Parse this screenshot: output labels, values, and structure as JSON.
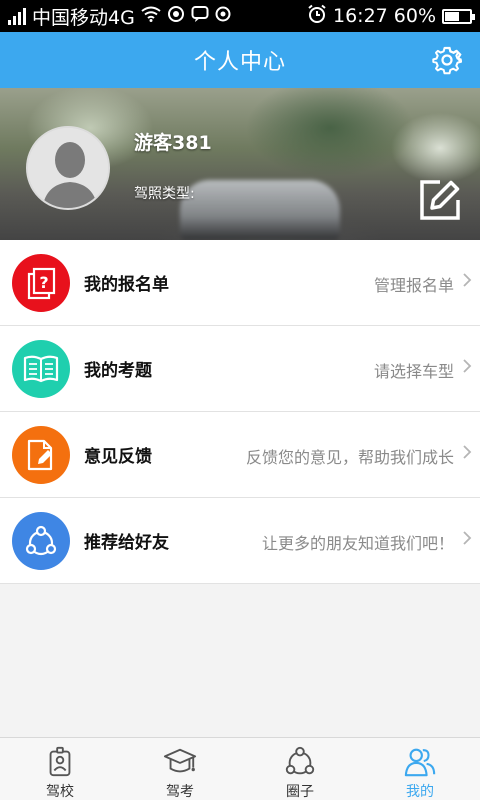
{
  "status_bar": {
    "carrier": "中国移动4G",
    "time": "16:27",
    "battery_percent": "60%",
    "battery_level": 0.6,
    "icons": [
      "signal-icon",
      "wifi-icon",
      "sync-icon",
      "chat-icon",
      "location-icon",
      "alarm-icon",
      "battery-icon"
    ]
  },
  "header": {
    "title": "个人中心",
    "settings_icon": "gear-icon"
  },
  "profile": {
    "username": "游客381",
    "license_type_label": "驾照类型:",
    "avatar_icon": "user-silhouette-icon",
    "edit_icon": "edit-icon"
  },
  "menu": {
    "items": [
      {
        "label": "我的报名单",
        "hint": "管理报名单",
        "icon": "question-doc-icon",
        "color": "#e8111c"
      },
      {
        "label": "我的考题",
        "hint": "请选择车型",
        "icon": "open-book-icon",
        "color": "#1fcfae"
      },
      {
        "label": "意见反馈",
        "hint": "反馈您的意见，帮助我们成长",
        "icon": "doc-pen-icon",
        "color": "#f4700f"
      },
      {
        "label": "推荐给好友",
        "hint": "让更多的朋友知道我们吧！",
        "icon": "share-icon",
        "color": "#3f86e4"
      }
    ],
    "chevron": "chevron-right-icon"
  },
  "bottom_nav": {
    "items": [
      {
        "label": "驾校",
        "icon": "badge-icon"
      },
      {
        "label": "驾考",
        "icon": "graduation-cap-icon"
      },
      {
        "label": "圈子",
        "icon": "circle-network-icon"
      },
      {
        "label": "我的",
        "icon": "people-icon"
      }
    ],
    "active_index": 3
  },
  "colors": {
    "primary": "#3ca8ef",
    "statusbar": "#000000",
    "background": "#f3f3f3"
  }
}
